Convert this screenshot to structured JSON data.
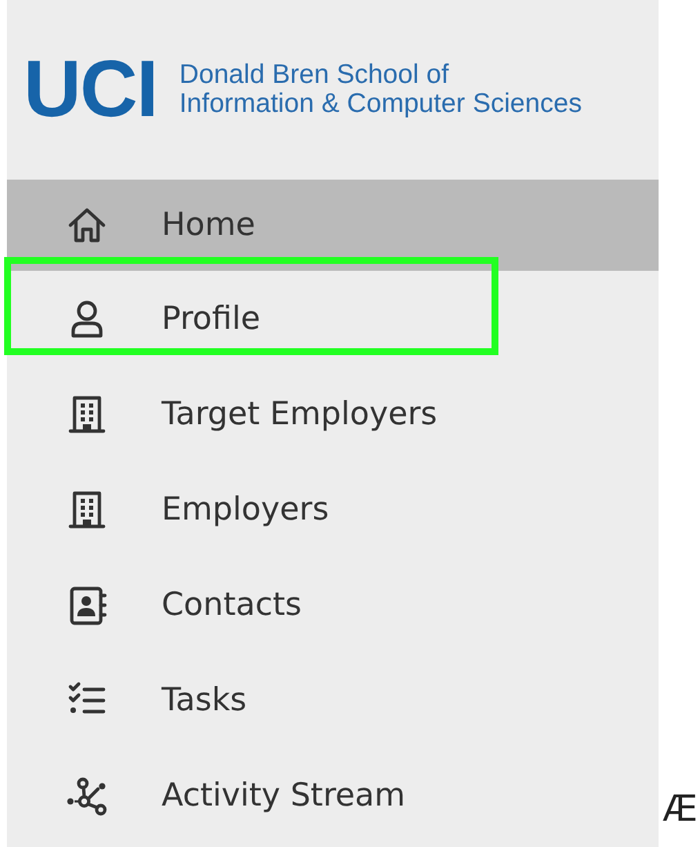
{
  "logo": {
    "mark": "UCI",
    "lines": [
      "Donald Bren School of",
      "Information & Computer Sciences"
    ]
  },
  "nav": [
    {
      "kind": "home",
      "label": "Home",
      "selected": true,
      "highlighted": false
    },
    {
      "kind": "person",
      "label": "Profile",
      "selected": false,
      "highlighted": true
    },
    {
      "kind": "building",
      "label": "Target Employers",
      "selected": false,
      "highlighted": false
    },
    {
      "kind": "building",
      "label": "Employers",
      "selected": false,
      "highlighted": false
    },
    {
      "kind": "contacts",
      "label": "Contacts",
      "selected": false,
      "highlighted": false
    },
    {
      "kind": "tasks",
      "label": "Tasks",
      "selected": false,
      "highlighted": false
    },
    {
      "kind": "network",
      "label": "Activity Stream",
      "selected": false,
      "highlighted": false
    }
  ],
  "stray_text": "Æ"
}
